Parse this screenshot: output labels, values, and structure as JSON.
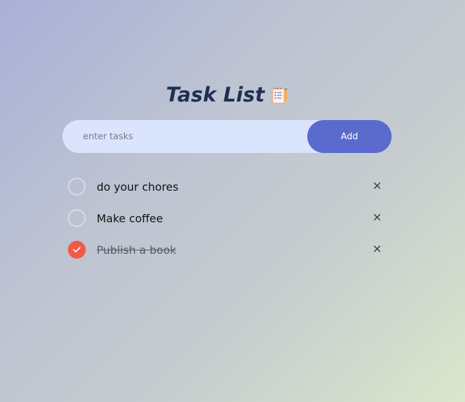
{
  "app": {
    "title": "Task List",
    "title_icon": "notepad-icon"
  },
  "input": {
    "placeholder": "enter tasks",
    "value": "",
    "add_label": "Add"
  },
  "colors": {
    "accent": "#5b6bcd",
    "checked": "#f25a47",
    "input_bg": "#dbe4fd",
    "title": "#1f2f52"
  },
  "tasks": [
    {
      "text": "do your chores",
      "checked": false,
      "delete_label": "×"
    },
    {
      "text": "Make coffee",
      "checked": false,
      "delete_label": "×"
    },
    {
      "text": "Publish a book",
      "checked": true,
      "delete_label": "×"
    }
  ]
}
